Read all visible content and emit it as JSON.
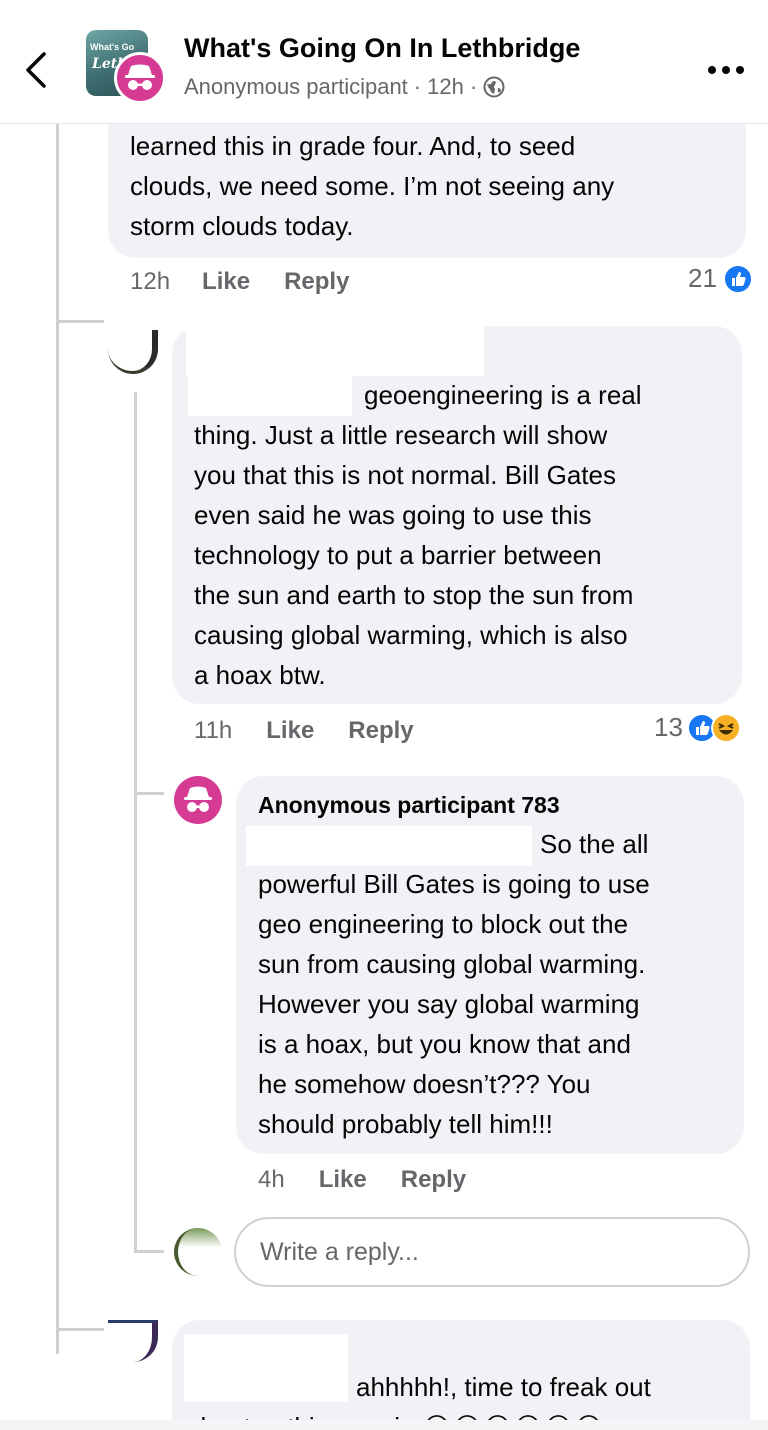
{
  "header": {
    "group_name": "What's Going On In Lethbridge",
    "poster": "Anonymous participant",
    "time": "12h",
    "group_image_text": "What's Go",
    "group_image_text2": "Lethb",
    "icons": [
      "back-arrow-icon",
      "incognito-icon",
      "globe-icon",
      "more-icon"
    ]
  },
  "comments": [
    {
      "text": "learned this in grade four. And, to seed\nclouds, we need some. I’m not seeing any\nstorm clouds today.",
      "time": "12h",
      "like_label": "Like",
      "reply_label": "Reply",
      "reaction_count": "21"
    },
    {
      "text": "geoengineering is a real\nthing.  Just a little research will show\nyou that this is not normal.  Bill Gates\neven said he was going to use this\ntechnology to put a barrier between\nthe sun and earth to stop the sun from\ncausing global warming, which is also\na hoax btw.",
      "time": "11h",
      "like_label": "Like",
      "reply_label": "Reply",
      "reaction_count": "13"
    },
    {
      "author": "Anonymous participant 783",
      "text": "So the all\npowerful Bill Gates is going to use\ngeo engineering to block out the\nsun from causing global warming.\nHowever you say global warming\nis a hoax, but you know that and\nhe somehow doesn’t???  You\nshould probably tell him!!!",
      "time": "4h",
      "like_label": "Like",
      "reply_label": "Reply"
    },
    {
      "text": "ahhhhh!, time to freak out\nabout nothing again 😂😂😂😂😂😂"
    }
  ],
  "reply_box": {
    "placeholder": "Write a reply..."
  },
  "colors": {
    "like_blue": "#1877f2",
    "anon_pink": "#d63b93",
    "bubble": "#f0f2f5",
    "meta_gray": "#65676b"
  }
}
